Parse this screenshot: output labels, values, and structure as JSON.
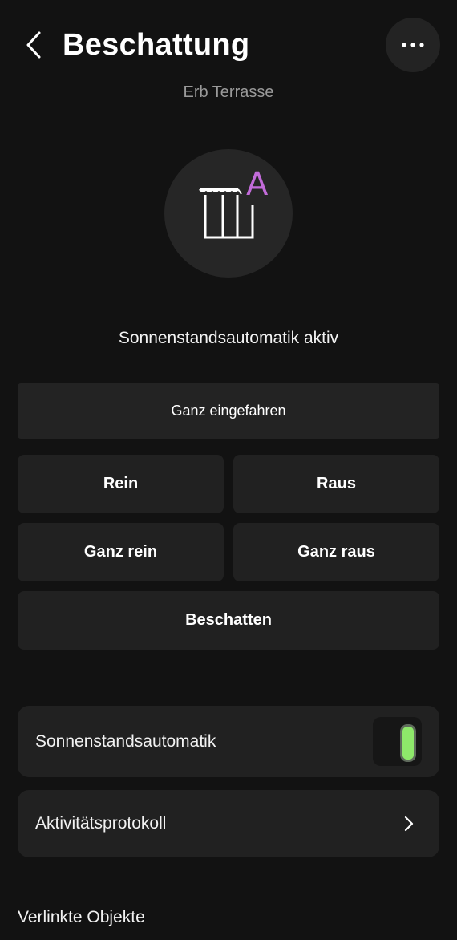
{
  "header": {
    "title": "Beschattung",
    "subtitle": "Erb Terrasse",
    "back_icon": "chevron-left-icon",
    "more_icon": "more-horizontal-icon"
  },
  "device": {
    "icon": "awning-icon",
    "mode_badge": "A",
    "mode_badge_color": "#c26bd9",
    "status": "Sonnenstandsautomatik aktiv"
  },
  "controls": {
    "position_label": "Ganz eingefahren",
    "rein": "Rein",
    "raus": "Raus",
    "ganz_rein": "Ganz rein",
    "ganz_raus": "Ganz raus",
    "beschatten": "Beschatten"
  },
  "settings": {
    "auto_label": "Sonnenstandsautomatik",
    "auto_enabled": true,
    "toggle_color": "#8ee86a",
    "log_label": "Aktivitätsprotokoll"
  },
  "linked": {
    "heading": "Verlinkte Objekte"
  }
}
